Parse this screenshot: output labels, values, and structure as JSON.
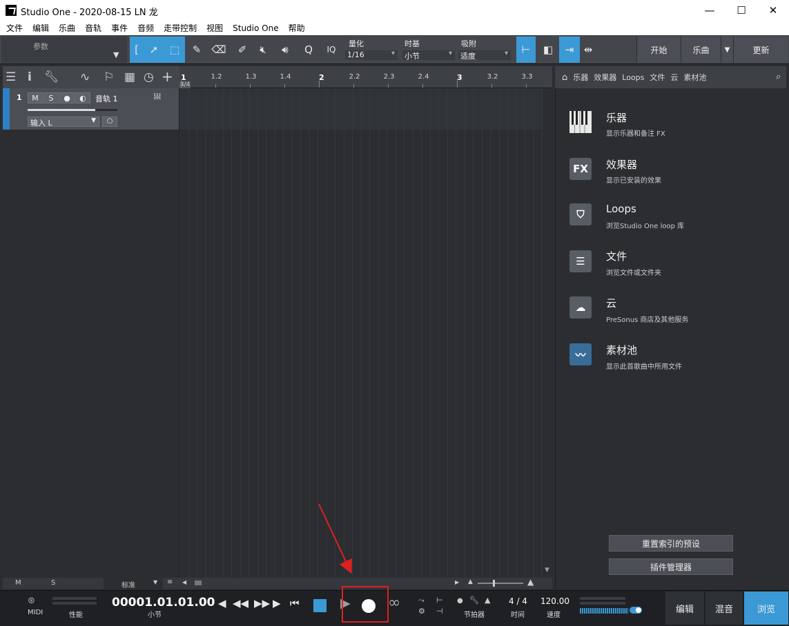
{
  "window": {
    "title": "Studio One - 2020-08-15 LN 龙",
    "minimize": "—",
    "maximize": "☐",
    "close": "✕"
  },
  "menu": [
    "文件",
    "编辑",
    "乐曲",
    "音轨",
    "事件",
    "音频",
    "走带控制",
    "视图",
    "Studio One",
    "帮助"
  ],
  "toolbar": {
    "params_label": "参数",
    "quantize_label": "量化",
    "quantize_value": "1/16",
    "timebase_label": "时基",
    "timebase_value": "小节",
    "snap_label": "吸附",
    "snap_value": "适度",
    "iq_label": "IQ",
    "start_button": "开始",
    "song_button": "乐曲",
    "update_button": "更新"
  },
  "track": {
    "number": "1",
    "mute": "M",
    "solo": "S",
    "name": "音轨 1",
    "input": "输入 L"
  },
  "ruler": {
    "time_signature": "4/4",
    "labels": [
      "1",
      "1.2",
      "1.3",
      "1.4",
      "2",
      "2.2",
      "2.3",
      "2.4",
      "3",
      "3.2",
      "3.3"
    ]
  },
  "arrange_bottom": {
    "m": "M",
    "s": "S",
    "mode": "标准"
  },
  "browser": {
    "tabs": [
      "乐器",
      "效果器",
      "Loops",
      "文件",
      "云",
      "素材池"
    ],
    "items": [
      {
        "title": "乐器",
        "subtitle": "显示乐器和备注 FX",
        "icon": "piano-icon"
      },
      {
        "title": "效果器",
        "subtitle": "显示已安装的效果",
        "icon": "fx-icon"
      },
      {
        "title": "Loops",
        "subtitle": "浏览Studio One loop 库",
        "icon": "loop-shield-icon"
      },
      {
        "title": "文件",
        "subtitle": "浏览文件或文件夹",
        "icon": "file-list-icon"
      },
      {
        "title": "云",
        "subtitle": "PreSonus 商店及其他服务",
        "icon": "cloud-icon"
      },
      {
        "title": "素材池",
        "subtitle": "显示此首歌曲中所用文件",
        "icon": "waveform-icon"
      }
    ],
    "fx_glyph": "FX",
    "reindex_button": "重置索引的预设",
    "plugin_manager_button": "插件管理器"
  },
  "transport": {
    "midi_label": "MIDI",
    "perf_label": "性能",
    "position": "00001.01.01.00",
    "position_unit": "小节",
    "metronome_label": "节拍器",
    "time_sig": "4 / 4",
    "time_label": "时间",
    "tempo": "120.00",
    "tempo_label": "速度",
    "edit_button": "编辑",
    "mix_button": "混音",
    "browse_button": "浏览"
  },
  "colors": {
    "accent": "#3b9ad6",
    "annotation": "#e02020"
  }
}
